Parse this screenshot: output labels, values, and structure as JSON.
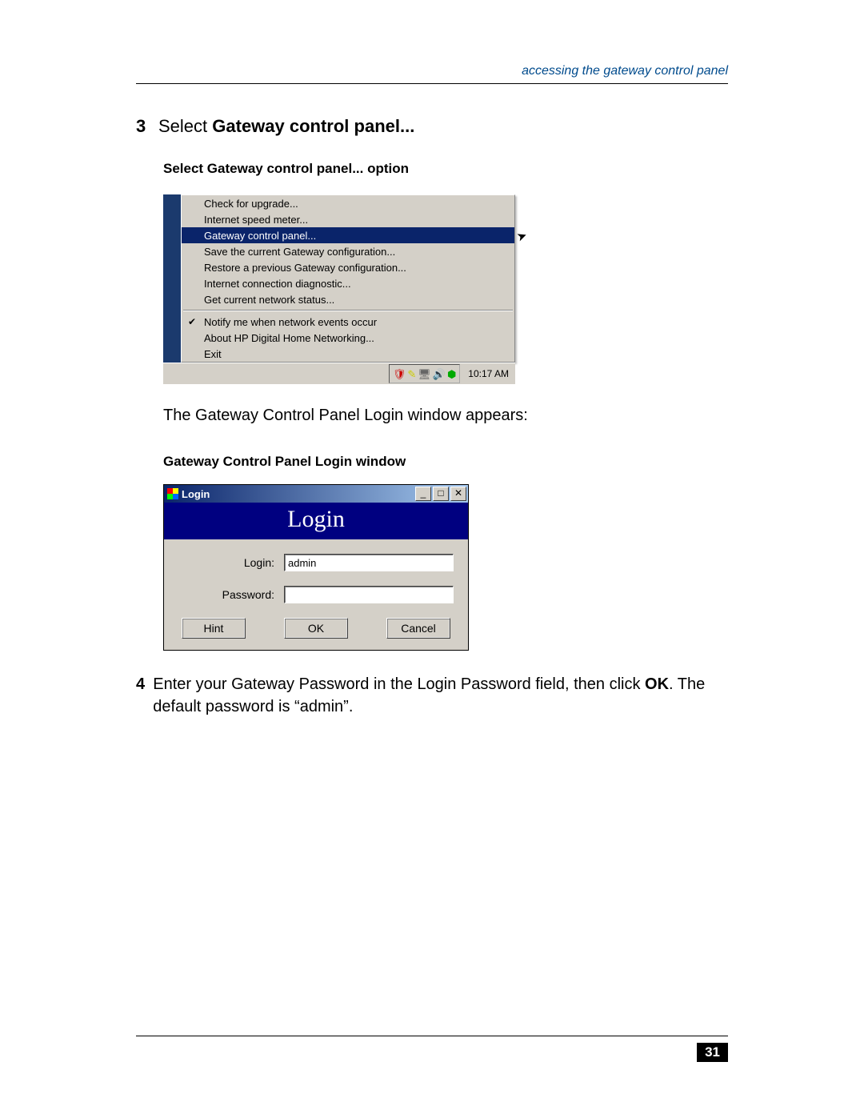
{
  "header": {
    "running_head": "accessing the gateway control panel"
  },
  "step3": {
    "number": "3",
    "prefix": "Select ",
    "bold": "Gateway control panel..."
  },
  "caption1": "Select Gateway control panel... option",
  "menu": {
    "items": [
      "Check for upgrade...",
      "Internet speed meter...",
      "Gateway control panel...",
      "Save the current Gateway configuration...",
      "Restore a previous Gateway configuration...",
      "Internet connection diagnostic...",
      "Get current network status..."
    ],
    "group2": [
      "Notify me when network events occur",
      "About HP Digital Home Networking...",
      "Exit"
    ],
    "highlight_index": 2,
    "check_index": 0,
    "clock": "10:17 AM"
  },
  "body1": "The Gateway Control Panel Login window appears:",
  "caption2": "Gateway Control Panel Login window",
  "login_window": {
    "title": "Login",
    "banner": "Login",
    "login_label": "Login:",
    "login_value": "admin",
    "password_label": "Password:",
    "password_value": "",
    "buttons": {
      "hint": "Hint",
      "ok": "OK",
      "cancel": "Cancel"
    }
  },
  "step4": {
    "number": "4",
    "pre": "Enter your Gateway Password in the Login Password field, then click ",
    "bold": "OK",
    "post": ". The default password is “admin”."
  },
  "page_number": "31"
}
